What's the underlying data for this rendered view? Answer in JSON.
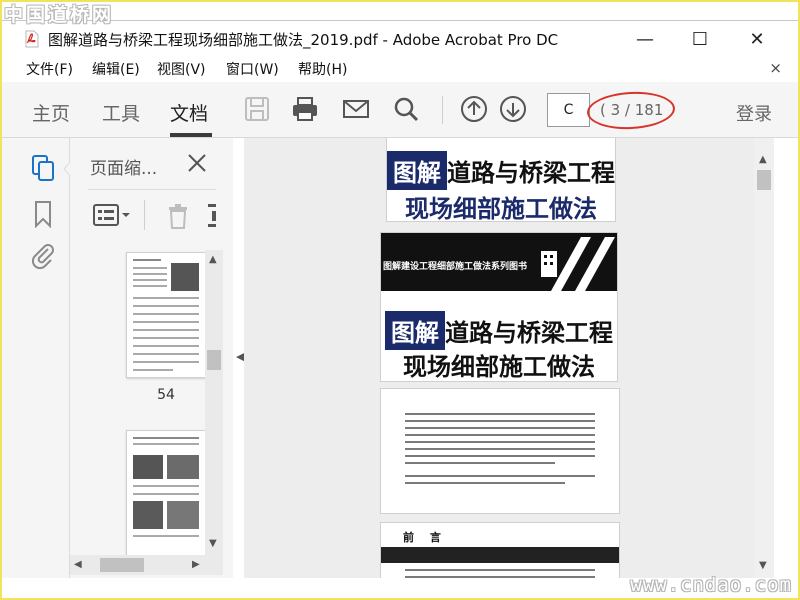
{
  "watermarks": {
    "top": "中国道桥网",
    "bottom": "www.cndao.com"
  },
  "window": {
    "title": "图解道路与桥梁工程现场细部施工做法_2019.pdf - Adobe Acrobat Pro DC",
    "minimize_glyph": "—",
    "maximize_glyph": "☐",
    "close_glyph": "✕"
  },
  "menu": {
    "items": [
      "文件(F)",
      "编辑(E)",
      "视图(V)",
      "窗口(W)",
      "帮助(H)"
    ],
    "close_glyph": "×"
  },
  "toolbar": {
    "tabs": [
      "主页",
      "工具",
      "文档"
    ],
    "active_tab": "文档",
    "page_input_value": "C",
    "page_count": "( 3 / 181",
    "login_label": "登录",
    "icons": [
      "save-icon",
      "print-icon",
      "mail-icon",
      "search-icon",
      "page-up-icon",
      "page-down-icon"
    ]
  },
  "left_rail": {
    "icons": [
      "page-thumbnails-icon",
      "bookmark-icon",
      "attachment-icon"
    ]
  },
  "thumbnail_panel": {
    "title": "页面缩...",
    "tools": [
      "thumbnail-options-icon",
      "delete-page-icon"
    ],
    "pages": [
      {
        "label": "54"
      },
      {
        "label": ""
      }
    ]
  },
  "document": {
    "cover_tu": "图解",
    "cover_line1": "道路与桥梁工程",
    "cover_line2": "现场细部施工做法",
    "series_title": "图解建设工程细部施工做法系列图书",
    "preface_title": "前  言"
  },
  "colors": {
    "accent": "#1a73c8",
    "cover_blue": "#1b2a6b",
    "annotation": "#d8332a"
  }
}
